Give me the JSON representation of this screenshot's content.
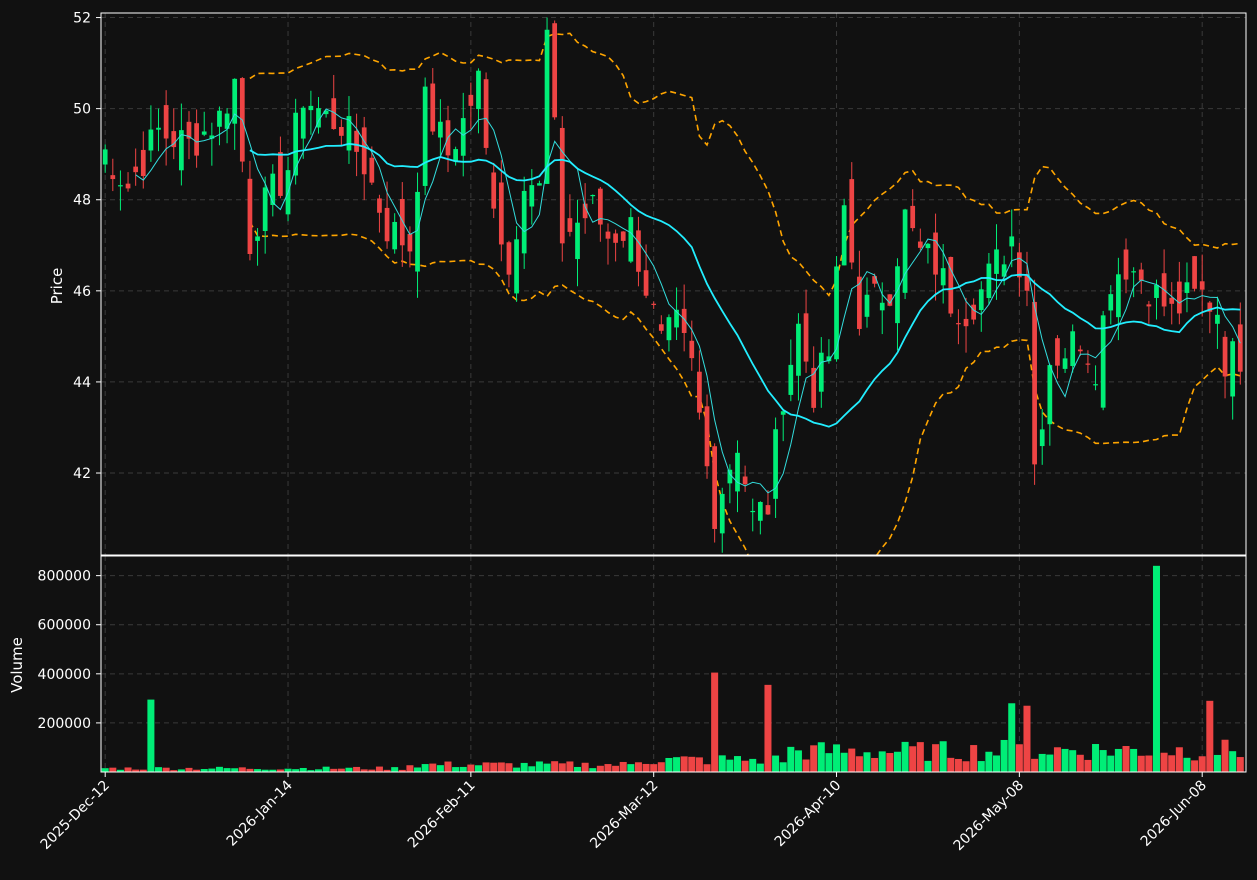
{
  "colors": {
    "background": "#111111",
    "up": "#00ee77",
    "down": "#ee4444",
    "ma_fast": "#33dddd",
    "ma_slow": "#22eeff",
    "bands": "#ffa500",
    "grid": "#3a3a3a",
    "axes": "#ffffff"
  },
  "chart_data": [
    {
      "type": "candlestick",
      "panel": "price",
      "ylabel": "Price",
      "ylim": [
        40.2,
        52.1
      ],
      "yticks": [
        "42",
        "44",
        "46",
        "48",
        "50",
        "52"
      ],
      "ytick_values": [
        42,
        44,
        46,
        48,
        50,
        52
      ],
      "grid": true,
      "bar_count": 150,
      "xticks": [
        {
          "label": "2025-Dec-12",
          "index": 0
        },
        {
          "label": "2026-Jan-14",
          "index": 24
        },
        {
          "label": "2026-Feb-11",
          "index": 48
        },
        {
          "label": "2026-Mar-12",
          "index": 72
        },
        {
          "label": "2026-Apr-10",
          "index": 96
        },
        {
          "label": "2026-May-08",
          "index": 120
        },
        {
          "label": "2026-Jun-08",
          "index": 144
        }
      ],
      "close_anchors": [
        [
          0,
          49.3
        ],
        [
          4,
          48.3
        ],
        [
          8,
          49.5
        ],
        [
          12,
          49.2
        ],
        [
          16,
          49.8
        ],
        [
          18,
          50.6
        ],
        [
          20,
          47.1
        ],
        [
          21,
          47.6
        ],
        [
          25,
          48.7
        ],
        [
          27,
          50.3
        ],
        [
          30,
          49.8
        ],
        [
          32,
          49.7
        ],
        [
          35,
          48.8
        ],
        [
          38,
          47.4
        ],
        [
          41,
          47.0
        ],
        [
          43,
          50.1
        ],
        [
          46,
          49.0
        ],
        [
          48,
          49.7
        ],
        [
          50,
          50.6
        ],
        [
          51,
          49.0
        ],
        [
          54,
          46.4
        ],
        [
          56,
          48.6
        ],
        [
          58,
          48.2
        ],
        [
          59,
          51.6
        ],
        [
          61,
          47.2
        ],
        [
          63,
          47.5
        ],
        [
          65,
          47.8
        ],
        [
          67,
          47.2
        ],
        [
          70,
          47.4
        ],
        [
          72,
          46.1
        ],
        [
          74,
          44.8
        ],
        [
          76,
          45.2
        ],
        [
          78,
          44.3
        ],
        [
          80,
          42.1
        ],
        [
          81,
          41.2
        ],
        [
          84,
          42.7
        ],
        [
          86,
          41.0
        ],
        [
          88,
          41.3
        ],
        [
          90,
          43.8
        ],
        [
          92,
          45.2
        ],
        [
          94,
          43.8
        ],
        [
          96,
          44.6
        ],
        [
          98,
          47.8
        ],
        [
          100,
          45.5
        ],
        [
          102,
          45.8
        ],
        [
          104,
          46.1
        ],
        [
          106,
          47.6
        ],
        [
          108,
          46.8
        ],
        [
          110,
          46.6
        ],
        [
          112,
          45.8
        ],
        [
          114,
          45.6
        ],
        [
          116,
          46.0
        ],
        [
          118,
          46.6
        ],
        [
          120,
          47.2
        ],
        [
          122,
          46.2
        ],
        [
          123,
          42.2
        ],
        [
          125,
          44.5
        ],
        [
          127,
          44.7
        ],
        [
          129,
          45.0
        ],
        [
          131,
          44.4
        ],
        [
          133,
          46.3
        ],
        [
          135,
          46.6
        ],
        [
          137,
          46.3
        ],
        [
          139,
          45.9
        ],
        [
          141,
          45.5
        ],
        [
          143,
          45.8
        ],
        [
          145,
          45.9
        ],
        [
          147,
          45.6
        ],
        [
          148,
          44.5
        ],
        [
          150,
          44.6
        ]
      ],
      "series": [
        {
          "name": "",
          "kind": "ma_fast",
          "window": 5
        },
        {
          "name": "",
          "kind": "ma_slow",
          "window": 20
        },
        {
          "name": "",
          "kind": "bands",
          "window": 20,
          "stdev": 2
        }
      ]
    },
    {
      "type": "bar",
      "panel": "volume",
      "ylabel": "Volume",
      "ylim": [
        0,
        880000
      ],
      "yticks": [
        "200000",
        "400000",
        "600000",
        "800000"
      ],
      "ytick_values": [
        200000,
        400000,
        600000,
        800000
      ],
      "grid": true,
      "spikes": [
        {
          "index": 6,
          "value": 295000
        },
        {
          "index": 80,
          "value": 405000
        },
        {
          "index": 87,
          "value": 355000
        },
        {
          "index": 119,
          "value": 280000
        },
        {
          "index": 121,
          "value": 270000
        },
        {
          "index": 138,
          "value": 840000
        },
        {
          "index": 145,
          "value": 290000
        }
      ]
    }
  ]
}
